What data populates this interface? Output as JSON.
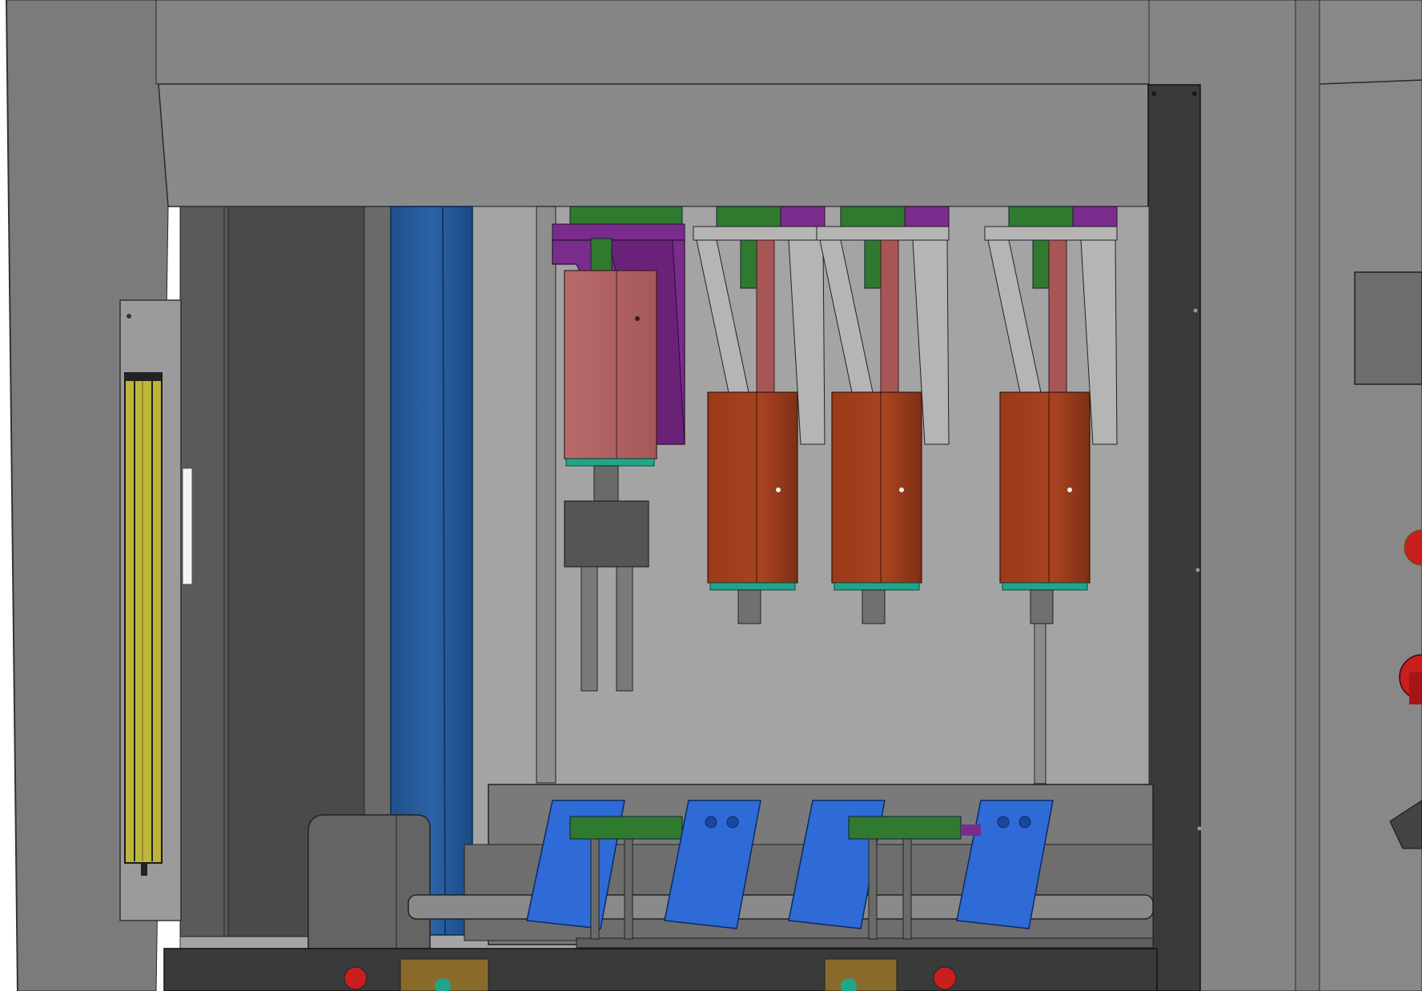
{
  "scene": {
    "subject": "cad-assembly-view",
    "colors": {
      "frame": "#7f7f7f",
      "frame_light": "#8a8a8a",
      "panel_dark": "#3c3c3c",
      "interior": "#a3a3a3",
      "blue_column": "#2a5fa0",
      "purple_bracket": "#7a2c8c",
      "pink_block": "#b46565",
      "orange_block": "#a43f1c",
      "green_part": "#2f7a2f",
      "teal_band": "#1fa58a",
      "blue_fixture": "#2e6bd6",
      "light_curtain": "#bdb63a",
      "red_button": "#c81e1e"
    },
    "icons": [
      "light-curtain-icon",
      "emergency-stop-icon",
      "rotary-switch-icon",
      "pilot-light-icon"
    ]
  }
}
